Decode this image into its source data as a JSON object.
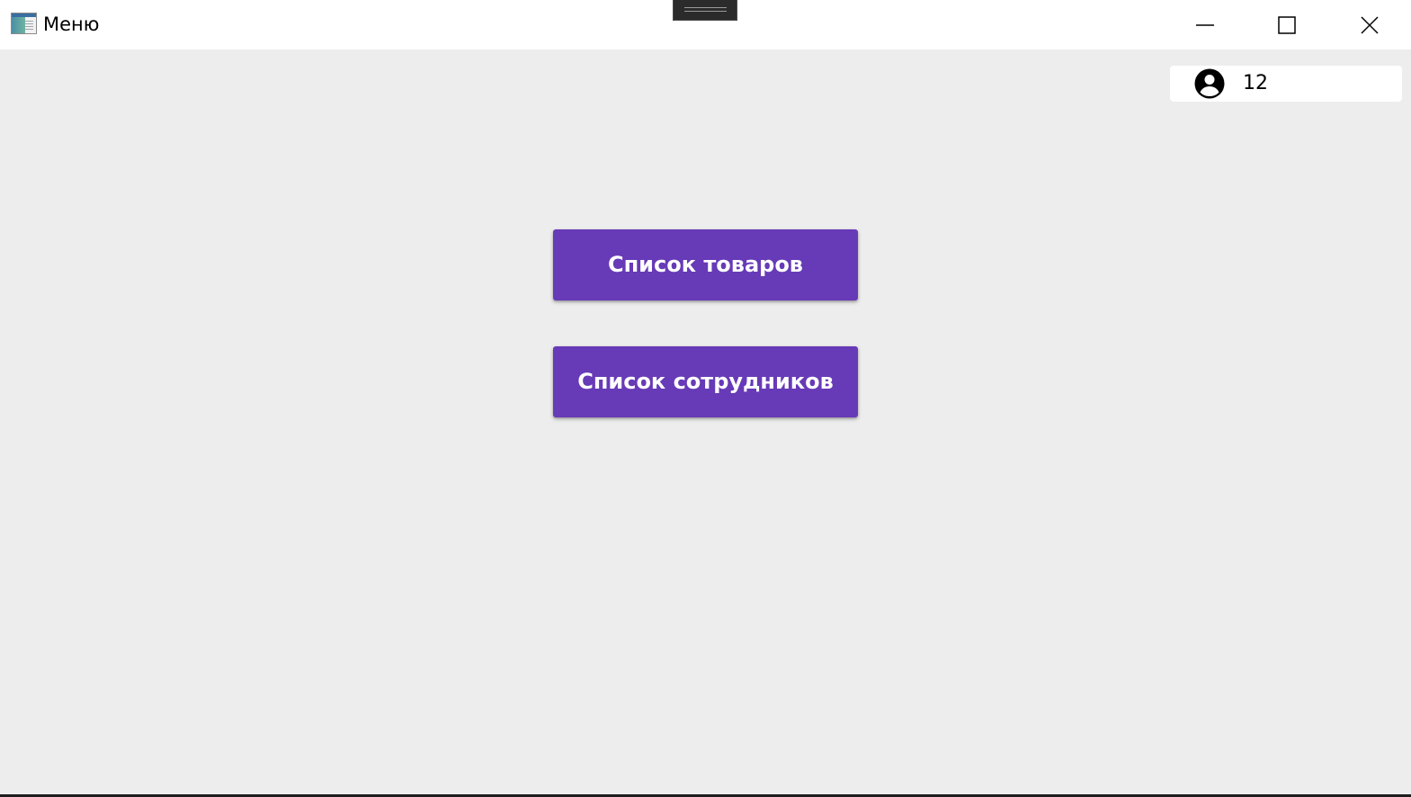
{
  "window": {
    "title": "Меню",
    "icon": "app-window-icon"
  },
  "user": {
    "icon": "account-circle-icon",
    "value": "12"
  },
  "menu": {
    "products_label": "Список товаров",
    "employees_label": "Список сотрудников"
  },
  "colors": {
    "accent": "#673ab7",
    "background": "#ededed",
    "titlebar": "#ffffff"
  }
}
